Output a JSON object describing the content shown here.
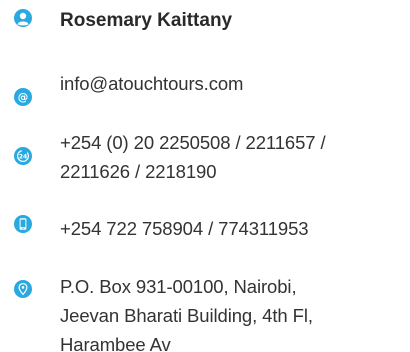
{
  "contact": {
    "name": "Rosemary Kaittany",
    "email": "info@atouchtours.com",
    "landline_line1": "+254 (0) 20 2250508 / 2211657 /",
    "landline_line2": "2211626 / 2218190",
    "mobile": "+254 722 758904 / 774311953",
    "address_line1": "P.O. Box 931-00100, Nairobi,",
    "address_line2": "Jeevan Bharati Building, 4th Fl,",
    "address_line3": "Harambee Av"
  },
  "icons": {
    "person": "user-icon",
    "email": "at-sign-icon",
    "phone": "phone-24-icon",
    "mobile": "mobile-phone-icon",
    "address": "map-pin-icon"
  },
  "colors": {
    "accent": "#2aa8e0",
    "text": "#333333"
  }
}
